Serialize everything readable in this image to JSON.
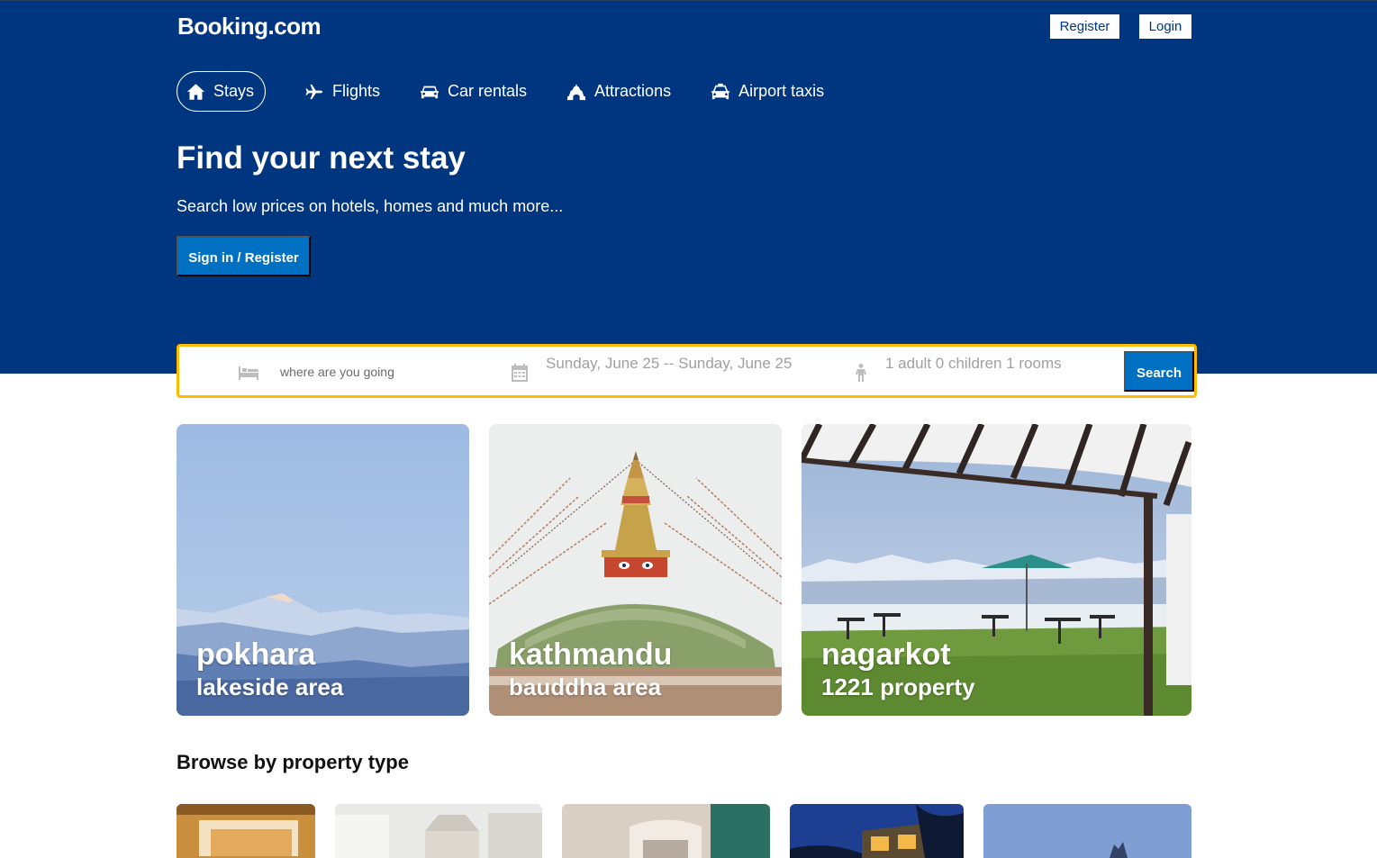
{
  "header": {
    "logo": "Booking.com",
    "register_label": "Register",
    "login_label": "Login"
  },
  "nav": {
    "items": [
      {
        "label": "Stays",
        "icon": "home-icon"
      },
      {
        "label": "Flights",
        "icon": "plane-icon"
      },
      {
        "label": "Car rentals",
        "icon": "car-icon"
      },
      {
        "label": "Attractions",
        "icon": "attractions-icon"
      },
      {
        "label": "Airport taxis",
        "icon": "taxi-icon"
      }
    ]
  },
  "hero": {
    "title": "Find your next stay",
    "subtitle": "Search low prices on hotels, homes and much more...",
    "signin_label": "Sign in / Register"
  },
  "search": {
    "destination_placeholder": "where are you going",
    "dates": "Sunday, June 25 -- Sunday, June 25",
    "guests": "1 adult 0 children 1 rooms",
    "search_label": "Search"
  },
  "featured": [
    {
      "title": "pokhara",
      "subtitle": "lakeside area"
    },
    {
      "title": "kathmandu",
      "subtitle": "bauddha area"
    },
    {
      "title": "nagarkot",
      "subtitle": "1221 property"
    }
  ],
  "browse": {
    "title": "Browse by property type"
  },
  "colors": {
    "brand_blue": "#003580",
    "action_blue": "#0071c2",
    "search_border": "#febb02"
  }
}
